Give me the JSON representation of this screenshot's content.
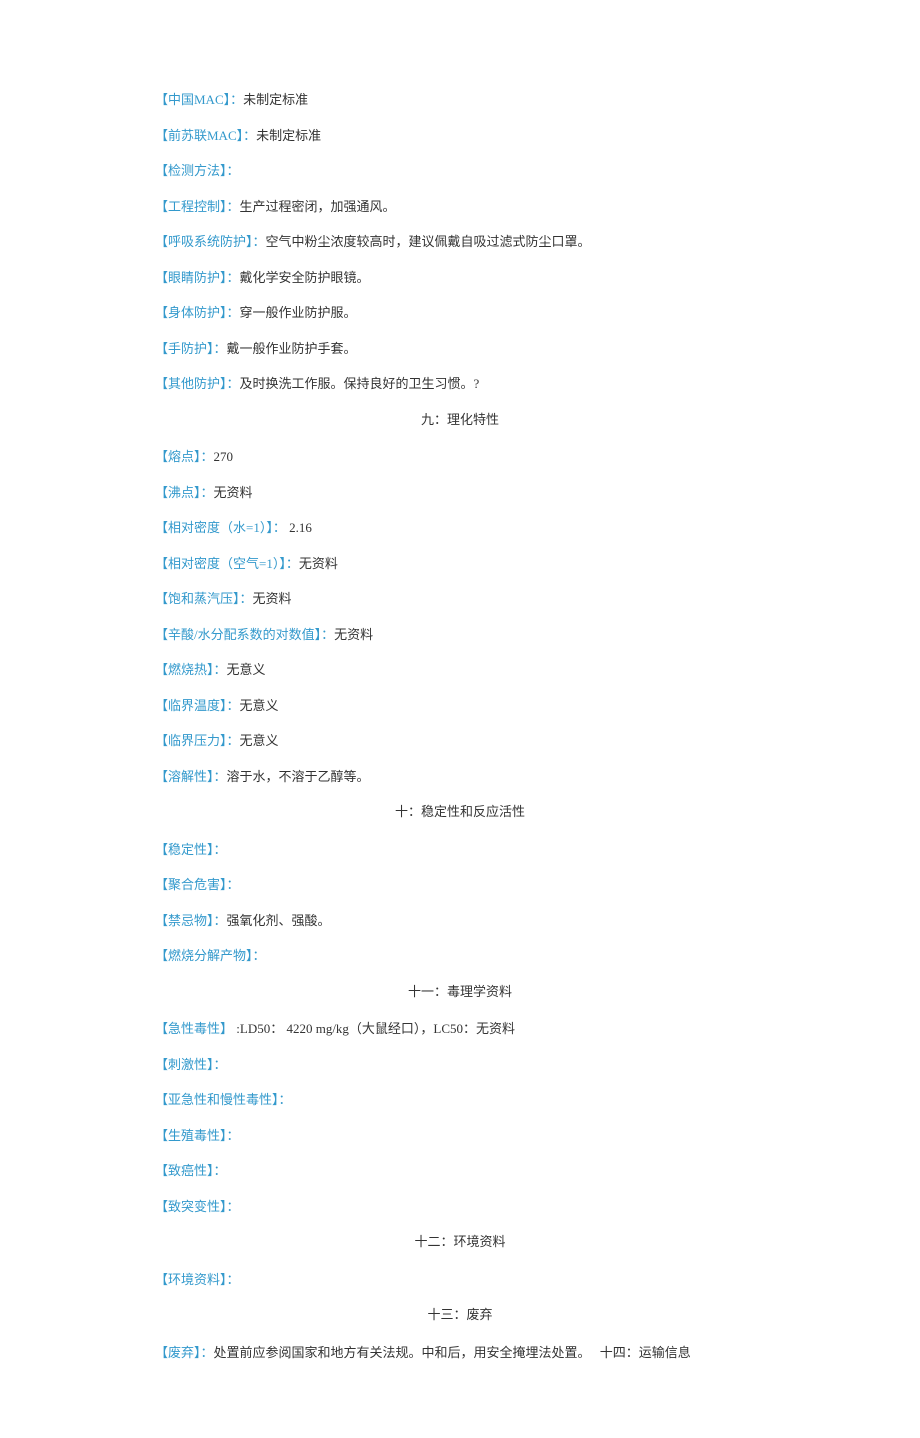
{
  "rows": {
    "china_mac": {
      "label": "【中国MAC】：",
      "value": "未制定标准"
    },
    "ussr_mac": {
      "label": "【前苏联MAC】：",
      "value": "未制定标准"
    },
    "detect": {
      "label": "【检测方法】：",
      "value": ""
    },
    "eng_ctrl": {
      "label": "【工程控制】：",
      "value": "生产过程密闭，加强通风。"
    },
    "resp": {
      "label": "【呼吸系统防护】：",
      "value": "空气中粉尘浓度较高时，建议佩戴自吸过滤式防尘口罩。"
    },
    "eye": {
      "label": "【眼睛防护】：",
      "value": "戴化学安全防护眼镜。"
    },
    "body": {
      "label": "【身体防护】：",
      "value": "穿一般作业防护服。"
    },
    "hand": {
      "label": "【手防护】：",
      "value": "戴一般作业防护手套。"
    },
    "other": {
      "label": "【其他防护】：",
      "value": "及时换洗工作服。保持良好的卫生习惯。?"
    },
    "melting": {
      "label": "【熔点】：",
      "value": "270"
    },
    "boiling": {
      "label": "【沸点】：",
      "value": "无资料"
    },
    "dens_water": {
      "label": "【相对密度（水=1）】：",
      "value": " 2.16"
    },
    "dens_air": {
      "label": "【相对密度（空气=1）】：",
      "value": "无资料"
    },
    "vapor": {
      "label": "【饱和蒸汽压】：",
      "value": "无资料"
    },
    "logp": {
      "label": "【辛酸/水分配系数的对数值】：",
      "value": "无资料"
    },
    "comb_heat": {
      "label": "【燃烧热】：",
      "value": "无意义"
    },
    "crit_temp": {
      "label": "【临界温度】：",
      "value": "无意义"
    },
    "crit_press": {
      "label": "【临界压力】：",
      "value": "无意义"
    },
    "solub": {
      "label": "【溶解性】：",
      "value": "溶于水，不溶于乙醇等。"
    },
    "stability": {
      "label": "【稳定性】：",
      "value": ""
    },
    "polymer": {
      "label": "【聚合危害】：",
      "value": ""
    },
    "incompat": {
      "label": "【禁忌物】：",
      "value": "强氧化剂、强酸。"
    },
    "decomp": {
      "label": "【燃烧分解产物】：",
      "value": ""
    },
    "acute": {
      "label": "【急性毒性】",
      "value": " :LD50： 4220 mg/kg（大鼠经口），LC50：无资料"
    },
    "irrit": {
      "label": "【刺激性】：",
      "value": ""
    },
    "subchronic": {
      "label": "【亚急性和慢性毒性】：",
      "value": ""
    },
    "repro": {
      "label": "【生殖毒性】：",
      "value": ""
    },
    "carcino": {
      "label": "【致癌性】：",
      "value": ""
    },
    "mutagen": {
      "label": "【致突变性】：",
      "value": ""
    },
    "env": {
      "label": "【环境资料】：",
      "value": ""
    },
    "disposal": {
      "label": "【废弃】：",
      "value": "处置前应参阅国家和地方有关法规。中和后，用安全掩埋法处置。",
      "trail": " 十四：运输信息"
    }
  },
  "sections": {
    "s9": "九：理化特性",
    "s10": "十：稳定性和反应活性",
    "s11": "十一：毒理学资料",
    "s12": "十二：环境资料",
    "s13": "十三：废弃"
  }
}
